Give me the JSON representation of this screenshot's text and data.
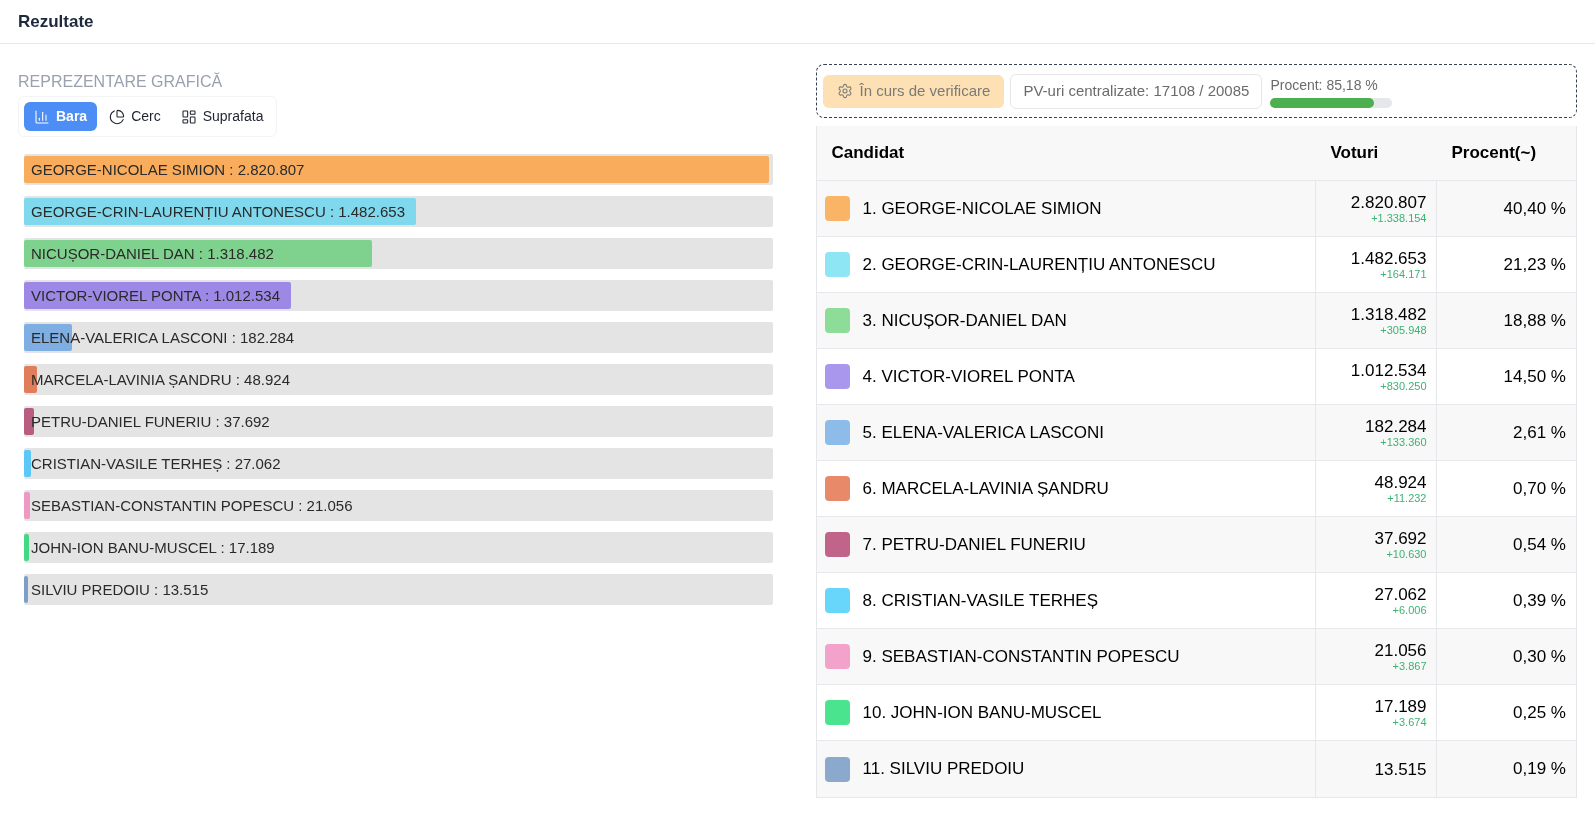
{
  "page_title": "Rezultate",
  "chart_section": {
    "title": "REPREZENTARE GRAFICĂ",
    "tabs": [
      {
        "label": "Bara",
        "kind": "bar",
        "selected": true
      },
      {
        "label": "Cerc",
        "kind": "pie",
        "selected": false
      },
      {
        "label": "Suprafata",
        "kind": "area",
        "selected": false
      }
    ]
  },
  "bars": [
    {
      "label": "GEORGE-NICOLAE SIMION : 2.820.807",
      "color": "#f9ad5c",
      "level": 1.0
    },
    {
      "label": "GEORGE-CRIN-LAURENȚIU ANTONESCU : 1.482.653",
      "color": "#7fd8ec",
      "level": 0.526
    },
    {
      "label": "NICUȘOR-DANIEL DAN : 1.318.482",
      "color": "#7fd18e",
      "level": 0.467
    },
    {
      "label": "VICTOR-VIOREL PONTA : 1.012.534",
      "color": "#9d88e6",
      "level": 0.359
    },
    {
      "label": "ELENA-VALERICA LASCONI : 182.284",
      "color": "#7eaee2",
      "level": 0.0646
    },
    {
      "label": "MARCELA-LAVINIA ȘANDRU : 48.924",
      "color": "#e07e5a",
      "level": 0.0173
    },
    {
      "label": "PETRU-DANIEL FUNERIU : 37.692",
      "color": "#b85d80",
      "level": 0.0134
    },
    {
      "label": "CRISTIAN-VASILE TERHEȘ : 27.062",
      "color": "#5cc8f6",
      "level": 0.0096
    },
    {
      "label": "SEBASTIAN-CONSTANTIN POPESCU : 21.056",
      "color": "#ef98c4",
      "level": 0.0075
    },
    {
      "label": "JOHN-ION BANU-MUSCEL : 17.189",
      "color": "#43d884",
      "level": 0.0061
    },
    {
      "label": "SILVIU PREDOIU : 13.515",
      "color": "#7d9fc6",
      "level": 0.0048
    }
  ],
  "status": {
    "badge": "În curs de verificare",
    "counter": "PV-uri centralizate: 17108 / 20085",
    "progress_label": "Procent: 85,18 %",
    "level": 0.8518
  },
  "table": {
    "columns": [
      "Candidat",
      "Voturi",
      "Procent(~)"
    ],
    "rows": [
      {
        "color": "#f9b565",
        "name": "1. GEORGE-NICOLAE SIMION",
        "votes": "2.820.807",
        "delta": "+1.338.154",
        "percent": "40,40 %"
      },
      {
        "color": "#8ee6f4",
        "name": "2. GEORGE-CRIN-LAURENȚIU ANTONESCU",
        "votes": "1.482.653",
        "delta": "+164.171",
        "percent": "21,23 %"
      },
      {
        "color": "#8ddc97",
        "name": "3. NICUȘOR-DANIEL DAN",
        "votes": "1.318.482",
        "delta": "+305.948",
        "percent": "18,88 %"
      },
      {
        "color": "#a897ec",
        "name": "4. VICTOR-VIOREL PONTA",
        "votes": "1.012.534",
        "delta": "+830.250",
        "percent": "14,50 %"
      },
      {
        "color": "#8dbbea",
        "name": "5. ELENA-VALERICA LASCONI",
        "votes": "182.284",
        "delta": "+133.360",
        "percent": "2,61 %"
      },
      {
        "color": "#e88a6a",
        "name": "6. MARCELA-LAVINIA ȘANDRU",
        "votes": "48.924",
        "delta": "+11.232",
        "percent": "0,70 %"
      },
      {
        "color": "#c0648a",
        "name": "7. PETRU-DANIEL FUNERIU",
        "votes": "37.692",
        "delta": "+10.630",
        "percent": "0,54 %"
      },
      {
        "color": "#68d6fb",
        "name": "8. CRISTIAN-VASILE TERHEȘ",
        "votes": "27.062",
        "delta": "+6.006",
        "percent": "0,39 %"
      },
      {
        "color": "#f3a2cb",
        "name": "9. SEBASTIAN-CONSTANTIN POPESCU",
        "votes": "21.056",
        "delta": "+3.867",
        "percent": "0,30 %"
      },
      {
        "color": "#4ae38e",
        "name": "10. JOHN-ION BANU-MUSCEL",
        "votes": "17.189",
        "delta": "+3.674",
        "percent": "0,25 %"
      },
      {
        "color": "#8aa9cc",
        "name": "11. SILVIU PREDOIU",
        "votes": "13.515",
        "percent": "0,19 %"
      }
    ]
  }
}
